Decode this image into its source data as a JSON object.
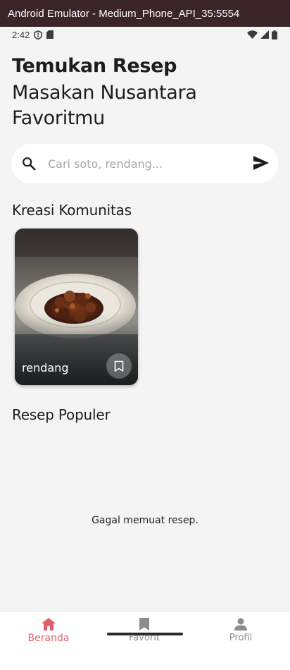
{
  "window": {
    "title": "Android Emulator - Medium_Phone_API_35:5554"
  },
  "status_bar": {
    "time": "2:42"
  },
  "hero": {
    "line1": "Temukan Resep",
    "line2": "Masakan Nusantara Favoritmu"
  },
  "search": {
    "placeholder": "Cari soto, rendang...",
    "value": ""
  },
  "sections": {
    "community": "Kreasi Komunitas",
    "popular": "Resep Populer"
  },
  "community_cards": [
    {
      "label": "rendang",
      "image": "rendang-dish-photo"
    }
  ],
  "popular": {
    "error": "Gagal memuat resep."
  },
  "bottom_nav": {
    "items": [
      {
        "label": "Beranda",
        "icon": "home-icon",
        "active": true
      },
      {
        "label": "Favorit",
        "icon": "bookmark-icon",
        "active": false
      },
      {
        "label": "Profil",
        "icon": "person-icon",
        "active": false
      }
    ]
  },
  "colors": {
    "accent": "#e0606a",
    "background": "#f4f4f4",
    "inactive": "#8d8d8d"
  }
}
